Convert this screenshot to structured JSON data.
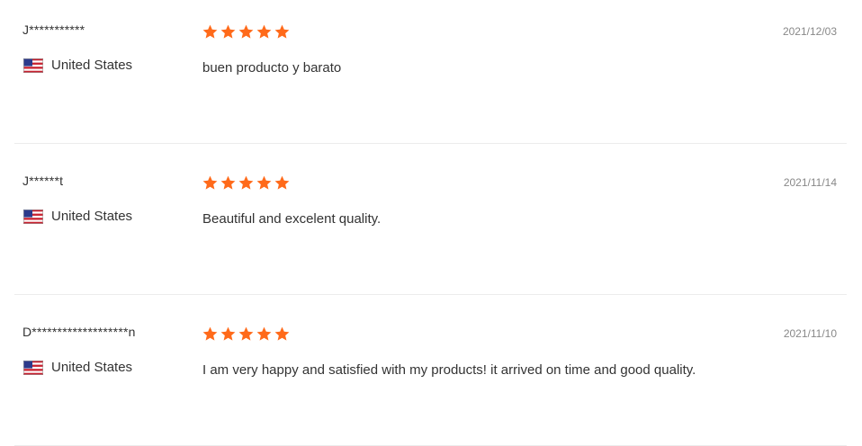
{
  "colors": {
    "star": "#ff6a1a",
    "divider": "#ececec",
    "text": "#333333",
    "date": "#888888"
  },
  "reviews": [
    {
      "user": "J***********",
      "country": "United States",
      "flag": "us-flag-icon",
      "rating": 5,
      "text": "buen producto y barato",
      "date": "2021/12/03"
    },
    {
      "user": "J******t",
      "country": "United States",
      "flag": "us-flag-icon",
      "rating": 5,
      "text": "Beautiful and excelent quality.",
      "date": "2021/11/14"
    },
    {
      "user": "D*******************n",
      "country": "United States",
      "flag": "us-flag-icon",
      "rating": 5,
      "text": "I am very happy and satisfied with my products! it arrived on time and good quality.",
      "date": "2021/11/10"
    }
  ]
}
